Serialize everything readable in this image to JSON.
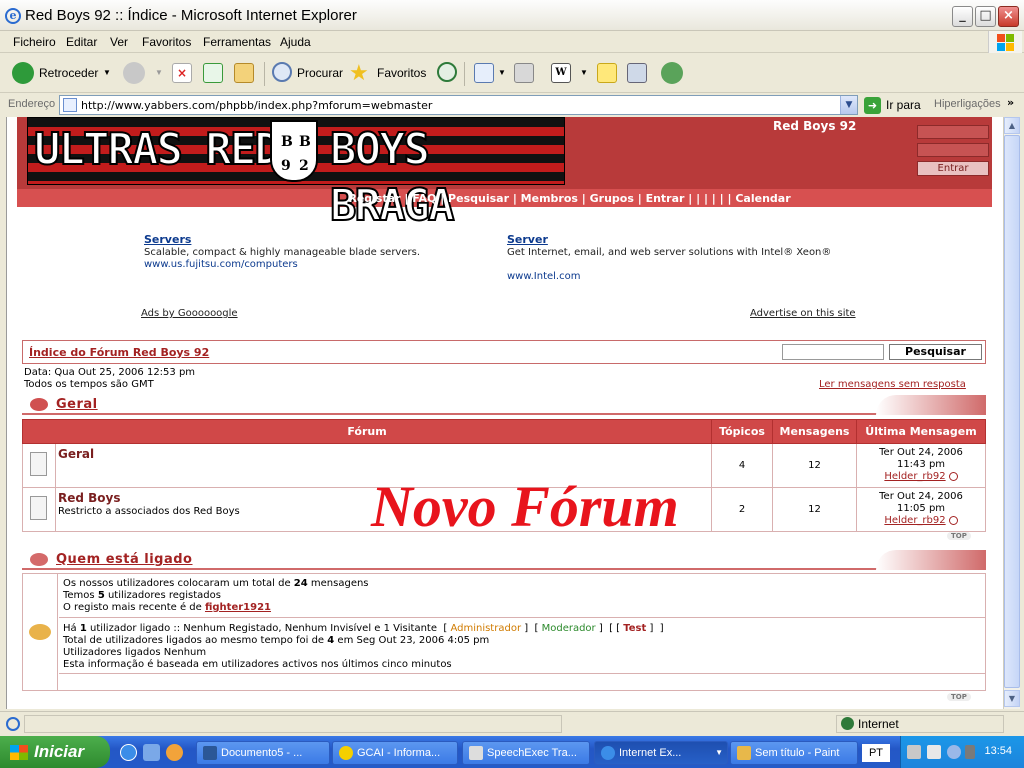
{
  "window": {
    "title": "Red Boys 92 :: Índice - Microsoft Internet Explorer"
  },
  "menu": [
    "Ficheiro",
    "Editar",
    "Ver",
    "Favoritos",
    "Ferramentas",
    "Ajuda"
  ],
  "toolbar": {
    "back": "Retroceder",
    "search": "Procurar",
    "favorites": "Favoritos"
  },
  "address": {
    "label": "Endereço",
    "url": "http://www.yabbers.com/phpbb/index.php?mforum=webmaster",
    "go": "Ir para",
    "links": "Hiperligações"
  },
  "header": {
    "logo_left": "ULTRAS RED",
    "logo_right": "BOYS BRAGA",
    "crest": [
      "B",
      "B",
      "9",
      "2"
    ],
    "site_name": "Red Boys 92",
    "login_button": "Entrar",
    "nav": "Registar | FAQ | Pesquisar | Membros | Grupos | Entrar | | | | | | Calendar"
  },
  "ads": [
    {
      "title": "Servers",
      "text": "Scalable, compact & highly manageable blade servers.",
      "url": "www.us.fujitsu.com/computers"
    },
    {
      "title": "Server",
      "text": "Get Internet, email, and web server solutions with Intel® Xeon®",
      "url": "www.Intel.com"
    }
  ],
  "ads_by": "Ads by Goooooogle",
  "advertise": "Advertise on this site",
  "index": {
    "title": "Índice do Fórum Red Boys 92",
    "search_button": "Pesquisar"
  },
  "info": {
    "date": "Data: Qua Out 25, 2006 12:53 pm",
    "timezone": "Todos os tempos são GMT",
    "unanswered": "Ler mensagens sem resposta"
  },
  "category": {
    "name": "Geral"
  },
  "table": {
    "headers": [
      "Fórum",
      "Tópicos",
      "Mensagens",
      "Última Mensagem"
    ],
    "rows": [
      {
        "name": "Geral",
        "desc": "",
        "topics": "4",
        "posts": "12",
        "last_date": "Ter Out 24, 2006",
        "last_time": "11:43 pm",
        "last_user": "Helder_rb92"
      },
      {
        "name": "Red Boys",
        "desc": "Restricto a associados dos Red Boys",
        "topics": "2",
        "posts": "12",
        "last_date": "Ter Out 24, 2006",
        "last_time": "11:05 pm",
        "last_user": "Helder_rb92"
      }
    ]
  },
  "overlay_text": "Novo Fórum",
  "top_label": "TOP",
  "online": {
    "title": "Quem está ligado",
    "l1_pre": "Os nossos utilizadores colocaram um total de ",
    "l1_num": "24",
    "l1_post": " mensagens",
    "l2_pre": "Temos ",
    "l2_num": "5",
    "l2_post": " utilizadores registados",
    "l3_pre": "O registo mais recente é de ",
    "l3_user": "fighter1921",
    "l4_pre": "Há ",
    "l4_num": "1",
    "l4_post": " utilizador ligado :: Nenhum Registado, Nenhum Invisível e 1 Visitante",
    "admin": "Administrador",
    "moderator": "Moderador",
    "test": "Test",
    "l5_pre": "Total de utilizadores ligados ao mesmo tempo foi de ",
    "l5_num": "4",
    "l5_post": " em Seg Out 23, 2006 4:05 pm",
    "l6": "Utilizadores ligados Nenhum",
    "l7": "Esta informação é baseada em utilizadores activos nos últimos cinco minutos"
  },
  "status": {
    "zone": "Internet"
  },
  "taskbar": {
    "start": "Iniciar",
    "tasks": [
      "Documento5 - ...",
      "GCAI - Informa...",
      "SpeechExec Tra...",
      "Internet Ex...",
      "Sem título - Paint"
    ],
    "lang": "PT",
    "clock": "13:54"
  }
}
